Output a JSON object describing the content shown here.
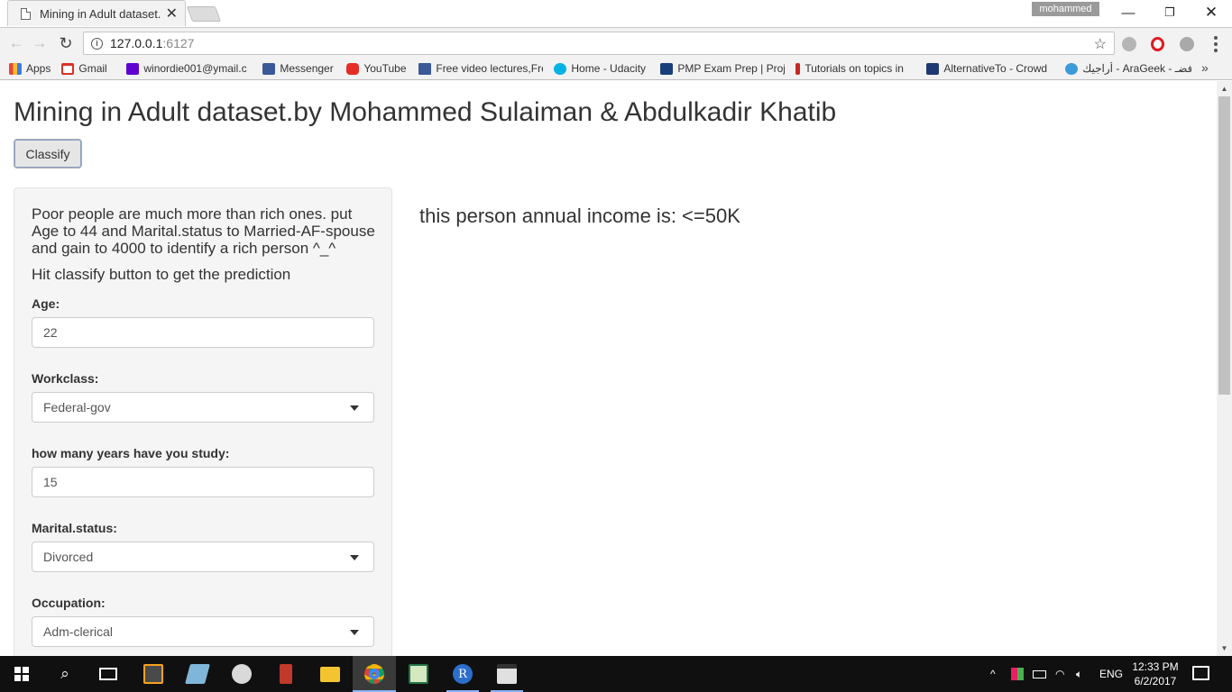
{
  "browser": {
    "tab_title": "Mining in Adult dataset.b",
    "tab_close": "✕",
    "user_badge": "mohammed",
    "window_controls": {
      "minimize": "—",
      "maximize": "❐",
      "close": "✕"
    },
    "url_host": "127.0.0.1",
    "url_port": ":6127",
    "bookmarks": [
      {
        "label": "Apps",
        "icon": "apps-grid-icon"
      },
      {
        "label": "Gmail",
        "icon": "gmail-icon"
      },
      {
        "label": "winordie001@ymail.c",
        "icon": "yahoo-icon"
      },
      {
        "label": "Messenger",
        "icon": "facebook-icon"
      },
      {
        "label": "YouTube",
        "icon": "youtube-icon"
      },
      {
        "label": "Free video lectures,Fre",
        "icon": "video-lectures-icon"
      },
      {
        "label": "Home - Udacity",
        "icon": "udacity-icon"
      },
      {
        "label": "PMP Exam Prep | Proj",
        "icon": "pmp-icon"
      },
      {
        "label": "Tutorials on topics in",
        "icon": "tutorials-icon"
      },
      {
        "label": "AlternativeTo - Crowd",
        "icon": "alternativeto-icon"
      },
      {
        "label": "أراجيك - AraGeek - أفضـ",
        "icon": "arageek-icon"
      }
    ],
    "bookmarks_more": "»"
  },
  "page": {
    "title": "Mining in Adult dataset.by Mohammed Sulaiman & Abdulkadir Khatib",
    "classify_button": "Classify",
    "intro": "Poor people are much more than rich ones. put Age to 44 and Marital.status to Married-AF-spouse and gain to 4000 to identify a rich person ^_^",
    "hint": "Hit classify button to get the prediction",
    "fields": {
      "age": {
        "label": "Age:",
        "value": "22"
      },
      "workclass": {
        "label": "Workclass:",
        "value": "Federal-gov"
      },
      "education": {
        "label": "how many years have you study:",
        "value": "15"
      },
      "marital": {
        "label": "Marital.status:",
        "value": "Divorced"
      },
      "occupation": {
        "label": "Occupation:",
        "value": "Adm-clerical"
      }
    },
    "result": "this person annual income is: <=50K"
  },
  "taskbar": {
    "lang": "ENG",
    "time": "12:33 PM",
    "date": "6/2/2017",
    "tray_up": "^"
  }
}
